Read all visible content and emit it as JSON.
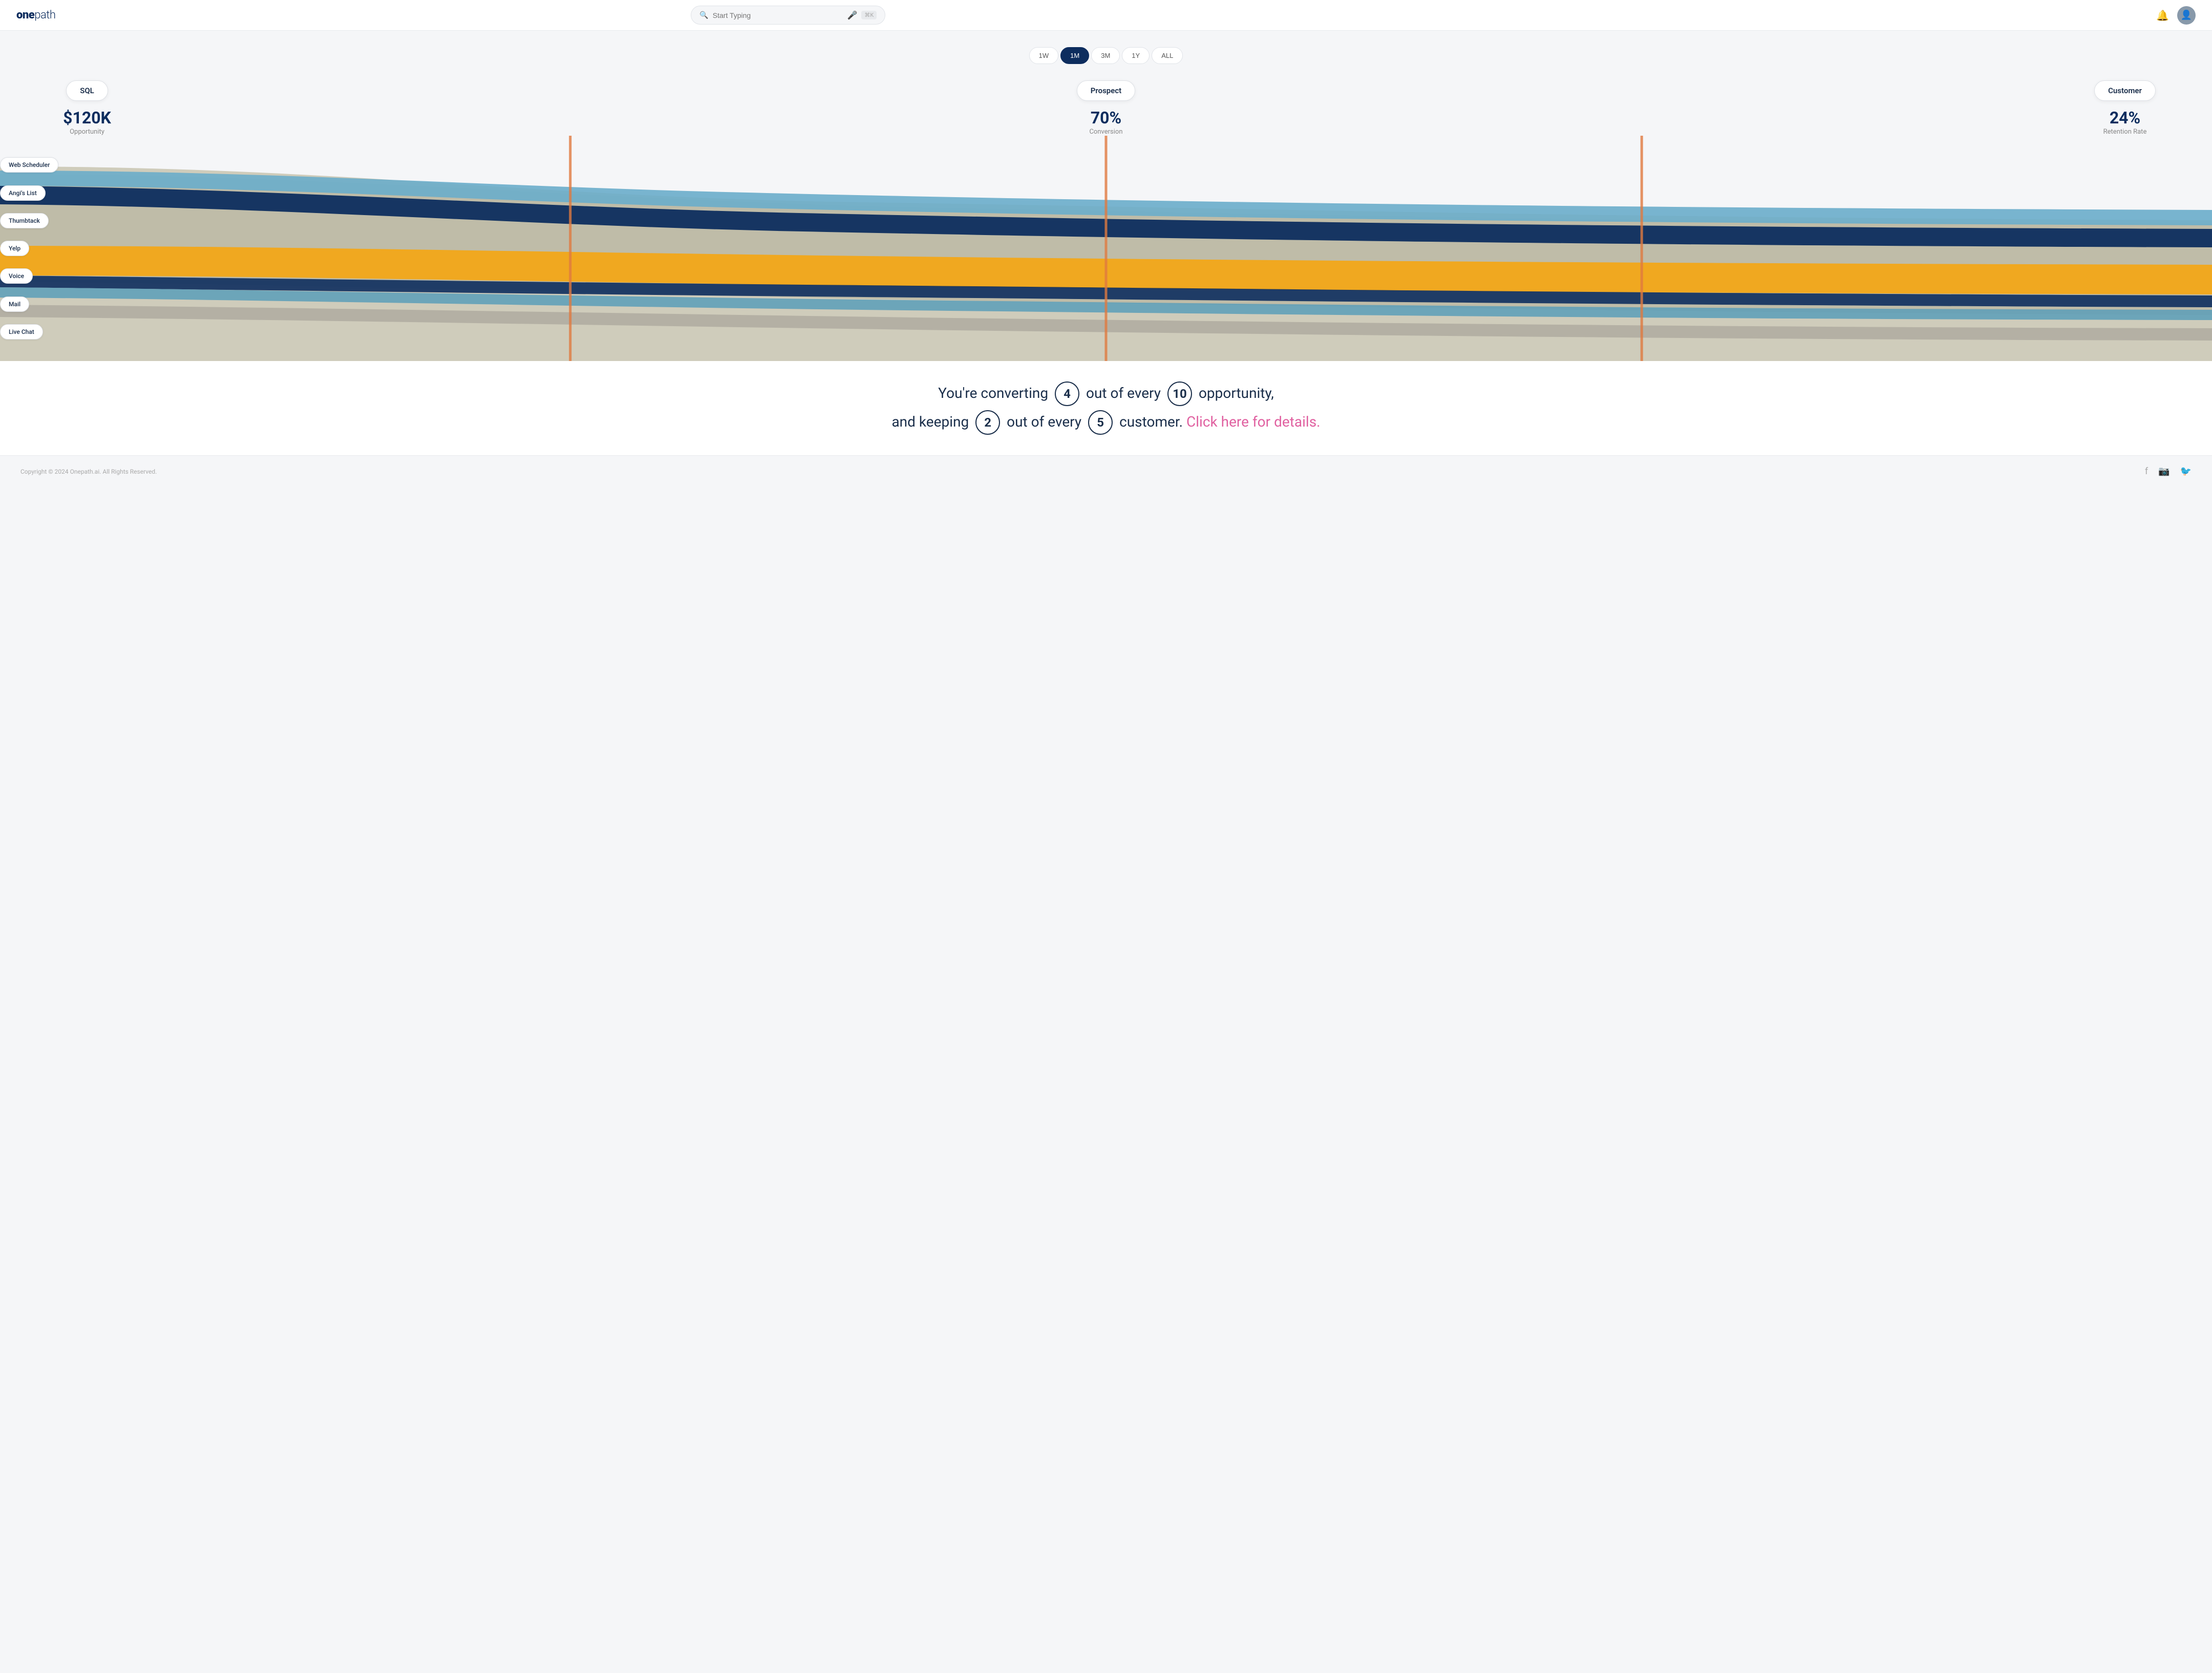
{
  "header": {
    "logo_bold": "one",
    "logo_light": "path",
    "search_placeholder": "Start Typing",
    "shortcut": "⌘K"
  },
  "time_filters": {
    "options": [
      "1W",
      "1M",
      "3M",
      "1Y",
      "ALL"
    ],
    "active": "1M"
  },
  "stages": [
    {
      "id": "sql",
      "label": "SQL",
      "metric": "$120K",
      "metric_label": "Opportunity"
    },
    {
      "id": "prospect",
      "label": "Prospect",
      "metric": "70%",
      "metric_label": "Conversion"
    },
    {
      "id": "customer",
      "label": "Customer",
      "metric": "24%",
      "metric_label": "Retention Rate"
    }
  ],
  "sources": [
    {
      "id": "web-scheduler",
      "label": "Web Scheduler"
    },
    {
      "id": "angis-list",
      "label": "Angi's List"
    },
    {
      "id": "thumbtack",
      "label": "Thumbtack"
    },
    {
      "id": "yelp",
      "label": "Yelp"
    },
    {
      "id": "voice",
      "label": "Voice"
    },
    {
      "id": "mail",
      "label": "Mail"
    },
    {
      "id": "live-chat",
      "label": "Live Chat"
    }
  ],
  "bottom_text": {
    "line1_prefix": "You're converting",
    "num1": "4",
    "line1_mid": "out of every",
    "num2": "10",
    "line1_suffix": "opportunity,",
    "line2_prefix": "and keeping",
    "num3": "2",
    "line2_mid": "out of every",
    "num4": "5",
    "line2_suffix": "customer.",
    "cta": "Click here for details."
  },
  "footer": {
    "copyright": "Copyright © 2024 Onepath.ai. All Rights Reserved."
  },
  "colors": {
    "sand": "#c8c4b0",
    "light_blue": "#5b9db8",
    "dark_blue": "#0d2d5e",
    "mid_blue": "#3a7fa0",
    "orange": "#f0a820",
    "teal": "#2ec4a9",
    "accent_orange": "#e07a40"
  }
}
